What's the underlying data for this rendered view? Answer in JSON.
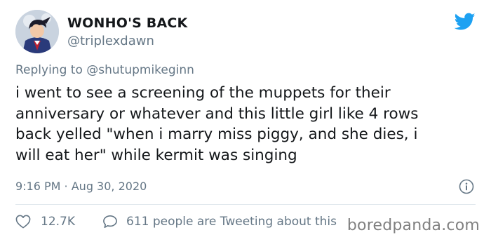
{
  "user": {
    "display_name": "WONHO'S BACK",
    "handle": "@triplexdawn"
  },
  "brand_icon": "twitter-bird-icon",
  "accent_color": "#1da1f2",
  "reply_context": {
    "prefix": "Replying to ",
    "mention": "@shutupmikeginn"
  },
  "tweet": {
    "lines": [
      "i went to see a screening of the muppets for their",
      "anniversary or whatever and this little girl like 4 rows",
      "back yelled \"when i marry miss piggy, and she dies, i",
      "will eat her\" while kermit was singing"
    ],
    "timestamp": "9:16 PM · Aug 30, 2020"
  },
  "actions": {
    "likes": "12.7K",
    "tweeting_about": "611 people are Tweeting about this"
  },
  "watermark": "boredpanda.com"
}
